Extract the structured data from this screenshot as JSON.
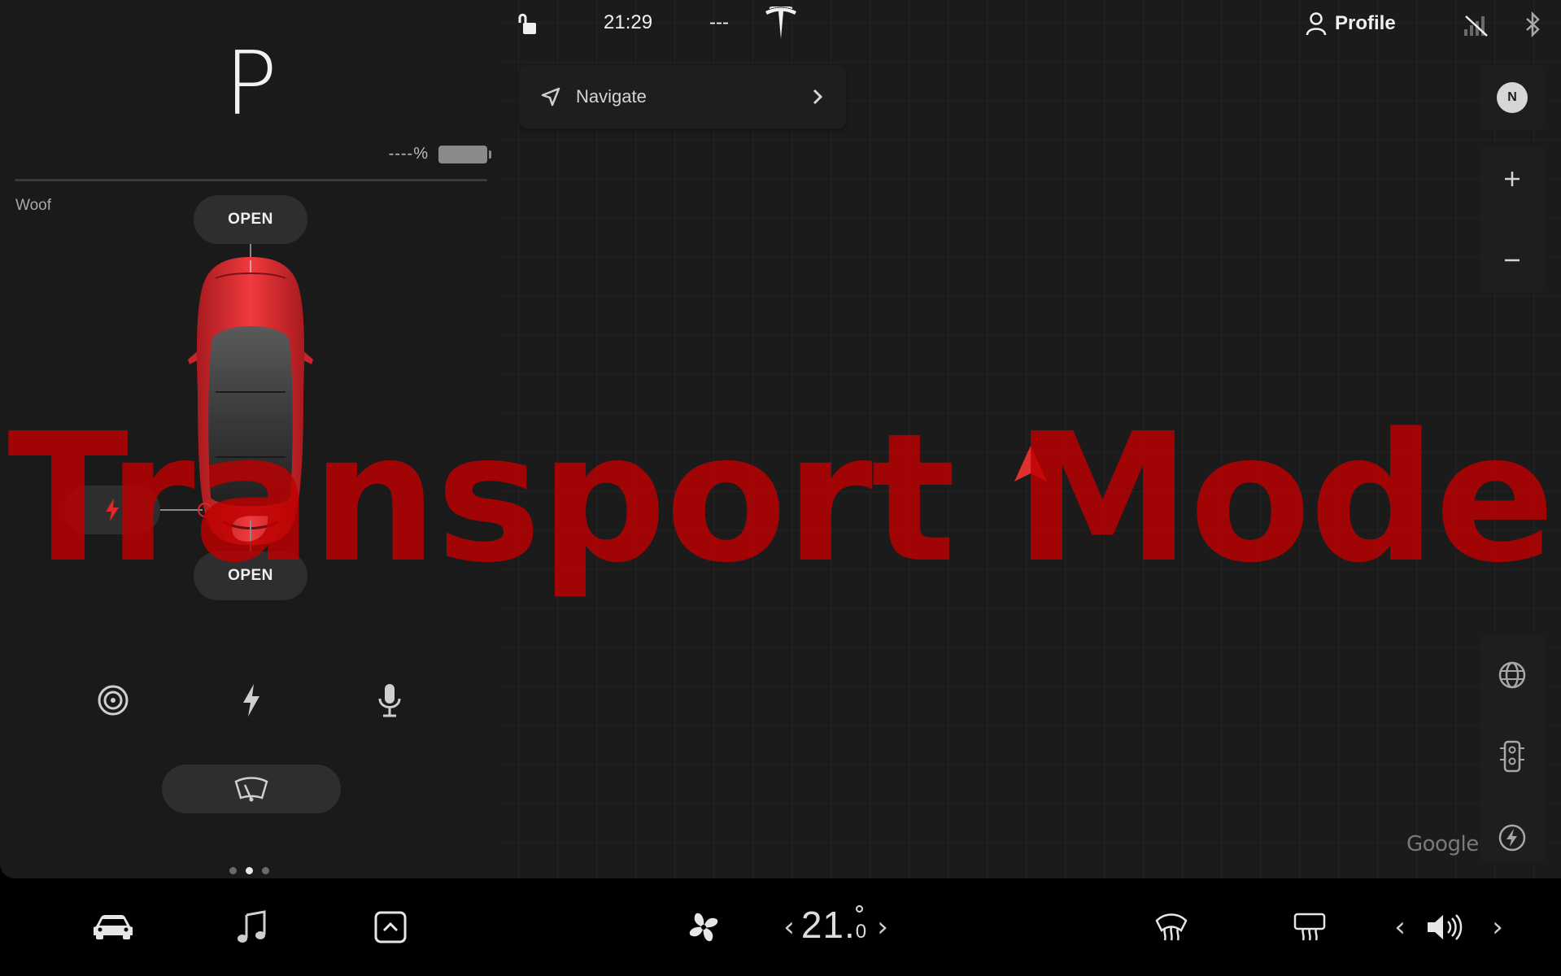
{
  "status_bar": {
    "time": "21:29",
    "temperature_outside": "---",
    "profile_label": "Profile"
  },
  "vehicle": {
    "gear": "P",
    "battery_percent": "----%",
    "name": "Woof",
    "frunk_label": "OPEN",
    "trunk_label": "OPEN",
    "body_color": "#d8262b"
  },
  "quick_controls": [
    {
      "icon": "dashcam-icon"
    },
    {
      "icon": "lightning-icon"
    },
    {
      "icon": "microphone-icon"
    }
  ],
  "card_pager": {
    "count": 3,
    "active_index": 1
  },
  "navigation": {
    "label": "Navigate"
  },
  "map": {
    "compass": "N",
    "attribution": "Google"
  },
  "overlay": {
    "text": "Transport Mode"
  },
  "climate": {
    "temperature_whole": "21.",
    "temperature_decimal": "0"
  },
  "colors": {
    "panel": "#1a1a1a",
    "map_bg": "#1b1b1b",
    "overlay_red": "#be0000",
    "dock_bg": "#000000"
  }
}
